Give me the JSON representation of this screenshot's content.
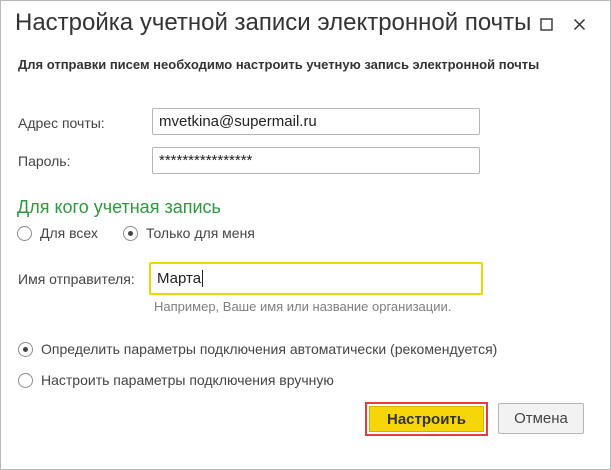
{
  "window": {
    "title": "Настройка учетной записи электронной почты"
  },
  "info_text": "Для отправки писем необходимо настроить учетную запись электронной почты",
  "fields": {
    "email": {
      "label": "Адрес почты:",
      "value": "mvetkina@supermail.ru"
    },
    "password": {
      "label": "Пароль:",
      "value": "****************"
    },
    "sender": {
      "label": "Имя отправителя:",
      "value": "Марта",
      "hint": "Например, Ваше имя или название организации."
    }
  },
  "account_for": {
    "title": "Для кого учетная запись",
    "options": [
      {
        "label": "Для всех",
        "selected": false
      },
      {
        "label": "Только для меня",
        "selected": true
      }
    ]
  },
  "connection": {
    "options": [
      {
        "label": "Определить параметры подключения автоматически (рекомендуется)",
        "selected": true
      },
      {
        "label": "Настроить параметры подключения вручную",
        "selected": false
      }
    ]
  },
  "buttons": {
    "configure": "Настроить",
    "cancel": "Отмена"
  },
  "colors": {
    "section_title": "#2a9b3a",
    "primary_button": "#f6d50b",
    "highlight_border": "#e43d3d",
    "active_field_border": "#f2d400"
  },
  "icons": {
    "maximize": "maximize-icon",
    "close": "close-icon"
  }
}
